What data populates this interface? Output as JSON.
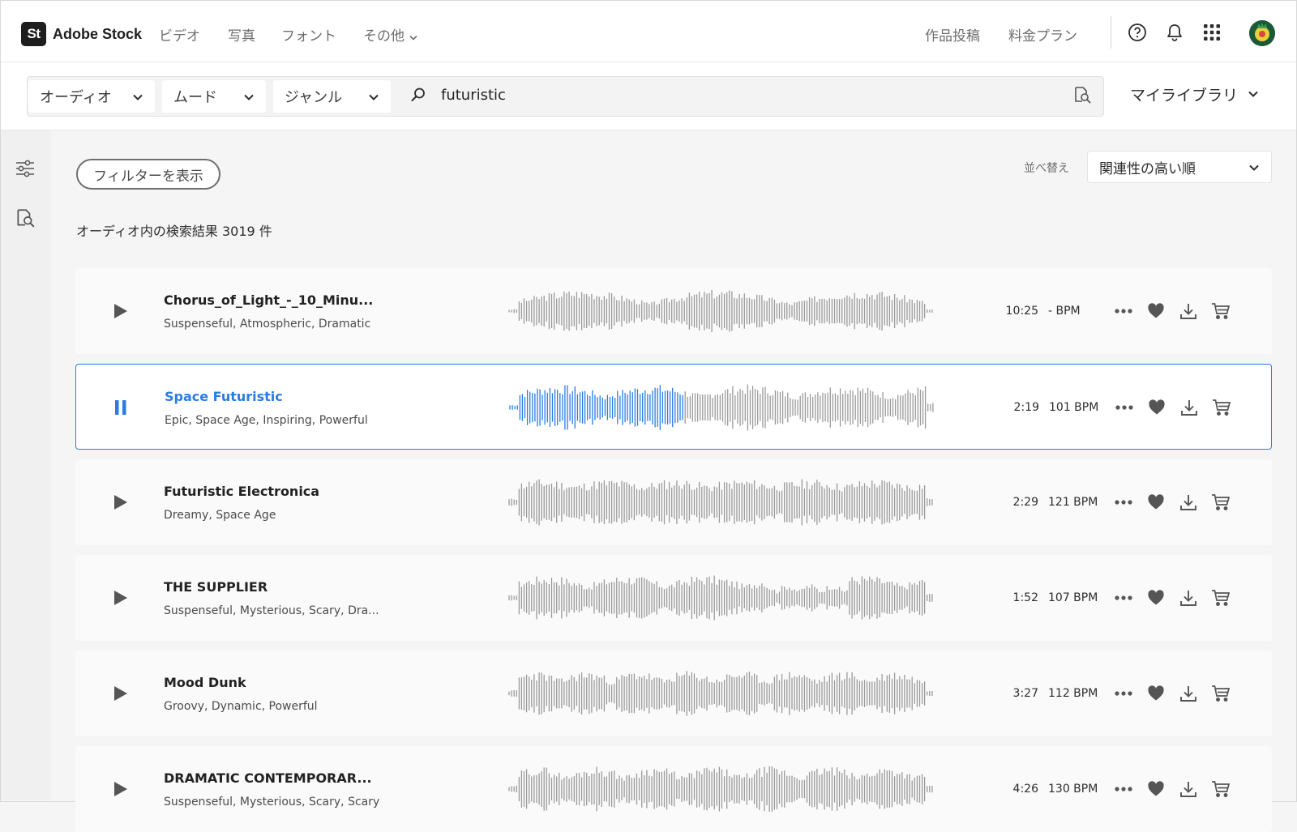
{
  "header": {
    "logo_mark": "St",
    "logo_text": "Adobe Stock",
    "nav": [
      {
        "label": "ビデオ"
      },
      {
        "label": "写真"
      },
      {
        "label": "フォント"
      },
      {
        "label": "その他"
      }
    ],
    "right_links": [
      {
        "label": "作品投稿"
      },
      {
        "label": "料金プラン"
      }
    ]
  },
  "search": {
    "asset_type": "オーディオ",
    "mood": "ムード",
    "genre": "ジャンル",
    "query": "futuristic"
  },
  "library_label": "マイライブラリ",
  "filter_button": "フィルターを表示",
  "sort": {
    "label": "並べ替え",
    "value": "関連性の高い順"
  },
  "results_text": "オーディオ内の検索結果 3019 件",
  "colors": {
    "accent": "#2b7ce3",
    "wave_gray": "#9a9a9a"
  },
  "tracks": [
    {
      "title": "Chorus_of_Light_-_10_Minu...",
      "tags": "Suspenseful, Atmospheric, Dramatic",
      "duration": "10:25",
      "bpm": "- BPM",
      "state": "play"
    },
    {
      "title": "Space Futuristic",
      "tags": "Epic, Space Age, Inspiring, Powerful",
      "duration": "2:19",
      "bpm": "101 BPM",
      "state": "pause",
      "progress": 0.41
    },
    {
      "title": "Futuristic Electronica",
      "tags": "Dreamy, Space Age",
      "duration": "2:29",
      "bpm": "121 BPM",
      "state": "play"
    },
    {
      "title": "THE SUPPLIER",
      "tags": "Suspenseful, Mysterious, Scary, Dra...",
      "duration": "1:52",
      "bpm": "107 BPM",
      "state": "play"
    },
    {
      "title": "Mood Dunk",
      "tags": "Groovy, Dynamic, Powerful",
      "duration": "3:27",
      "bpm": "112 BPM",
      "state": "play"
    },
    {
      "title": "DRAMATIC CONTEMPORAR...",
      "tags": "Suspenseful, Mysterious, Scary, Scary",
      "duration": "4:26",
      "bpm": "130 BPM",
      "state": "play"
    }
  ]
}
